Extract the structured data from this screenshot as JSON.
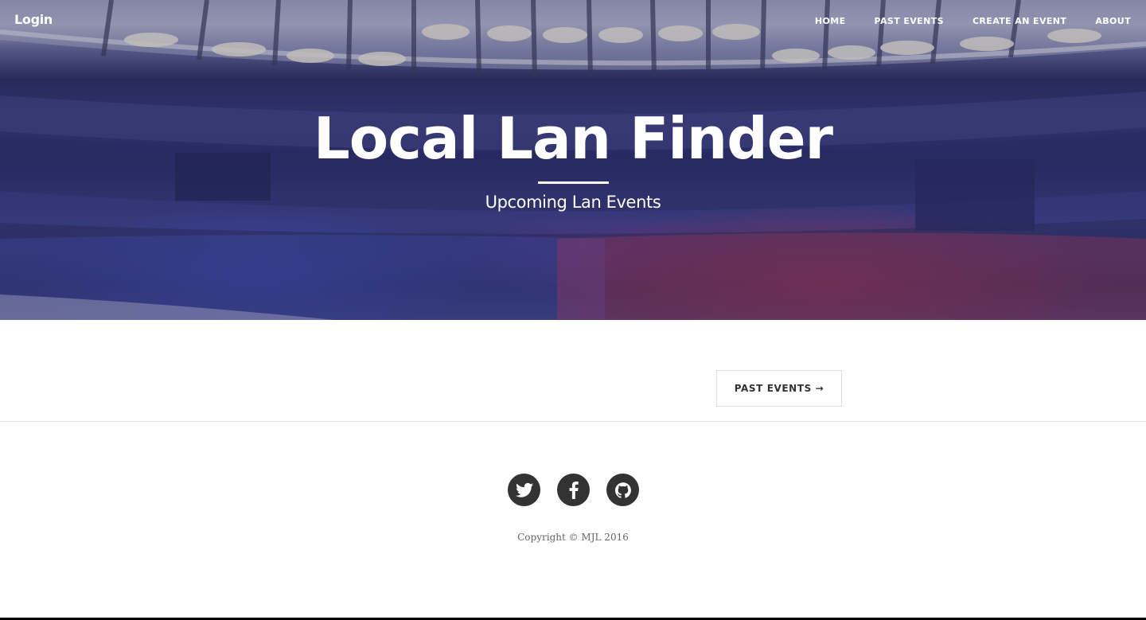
{
  "header": {
    "login_label": "Login",
    "nav": [
      {
        "label": "HOME"
      },
      {
        "label": "PAST EVENTS"
      },
      {
        "label": "CREATE AN EVENT"
      },
      {
        "label": "ABOUT"
      }
    ]
  },
  "hero": {
    "title": "Local Lan Finder",
    "subtitle": "Upcoming Lan Events"
  },
  "content": {
    "past_events_button": "PAST EVENTS →"
  },
  "footer": {
    "social": [
      {
        "icon": "twitter-icon"
      },
      {
        "icon": "facebook-icon"
      },
      {
        "icon": "github-icon"
      }
    ],
    "copyright": "Copyright © MJL 2016"
  },
  "colors": {
    "footer_icon_bg": "#333333",
    "text_dark": "#333333",
    "rule": "#e5e5e5"
  }
}
